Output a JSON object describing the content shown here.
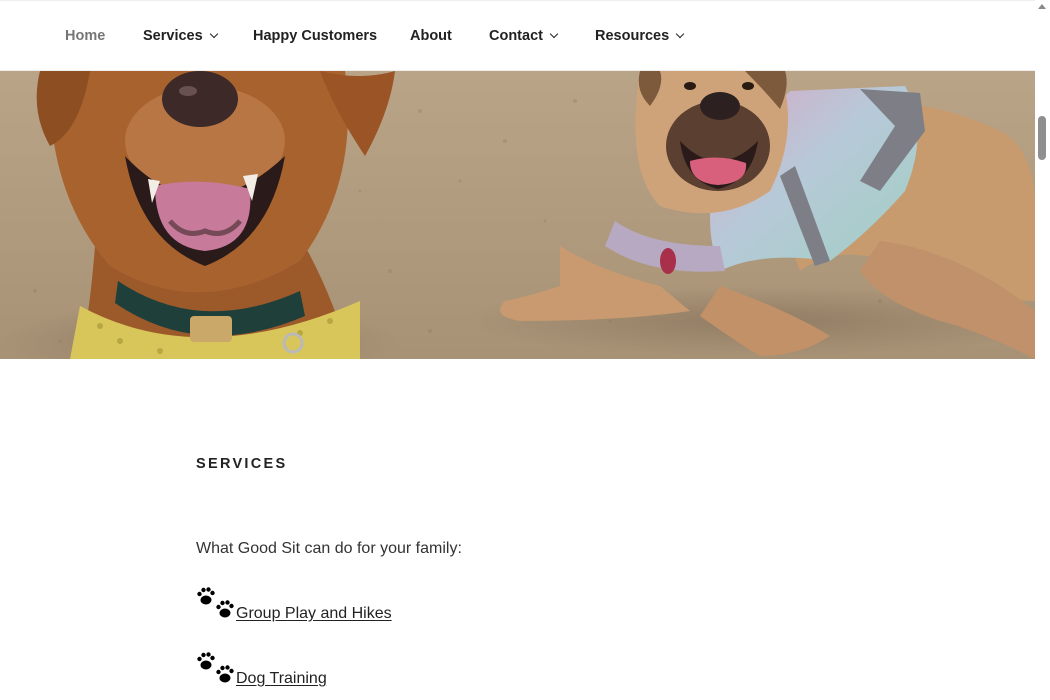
{
  "nav": {
    "items": [
      {
        "label": "Home",
        "current": true,
        "has_dropdown": false
      },
      {
        "label": "Services",
        "current": false,
        "has_dropdown": true
      },
      {
        "label": "Happy Customers",
        "current": false,
        "has_dropdown": false
      },
      {
        "label": "About",
        "current": false,
        "has_dropdown": false
      },
      {
        "label": "Contact",
        "current": false,
        "has_dropdown": true
      },
      {
        "label": "Resources",
        "current": false,
        "has_dropdown": true
      }
    ]
  },
  "hero": {
    "image": "photo of two smiling dogs lying on sand"
  },
  "main": {
    "section_title": "SERVICES",
    "intro": "What Good Sit can do for your family:",
    "services": [
      {
        "icon": "paw-prints-icon",
        "label": "Group Play and Hikes"
      },
      {
        "icon": "paw-prints-icon",
        "label": "Dog Training"
      }
    ]
  },
  "colors": {
    "text": "#222222",
    "nav_current": "#767676",
    "background": "#ffffff"
  }
}
